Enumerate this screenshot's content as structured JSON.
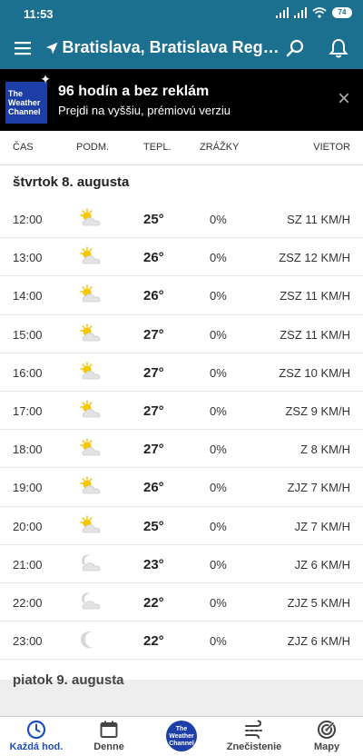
{
  "status_bar": {
    "time": "11:53",
    "battery": "74"
  },
  "app_bar": {
    "location": "Bratislava, Bratislava Region ..."
  },
  "promo": {
    "logo_lines": [
      "The",
      "Weather",
      "Channel"
    ],
    "title": "96 hodín a bez reklám",
    "subtitle": "Prejdi na vyššiu, prémiovú verziu"
  },
  "table_header": {
    "time": "ČAS",
    "condition": "PODM.",
    "temperature": "TEPL.",
    "precipitation": "ZRÁŽKY",
    "wind": "VIETOR"
  },
  "day": "štvrtok 8. augusta",
  "rows": [
    {
      "time": "12:00",
      "icon": "partly-sunny-icon",
      "temp": "25°",
      "precip": "0%",
      "wind": "SZ 11 KM/H"
    },
    {
      "time": "13:00",
      "icon": "partly-sunny-icon",
      "temp": "26°",
      "precip": "0%",
      "wind": "ZSZ 12 KM/H"
    },
    {
      "time": "14:00",
      "icon": "partly-sunny-icon",
      "temp": "26°",
      "precip": "0%",
      "wind": "ZSZ 11 KM/H"
    },
    {
      "time": "15:00",
      "icon": "partly-sunny-icon",
      "temp": "27°",
      "precip": "0%",
      "wind": "ZSZ 11 KM/H"
    },
    {
      "time": "16:00",
      "icon": "partly-sunny-icon",
      "temp": "27°",
      "precip": "0%",
      "wind": "ZSZ 10 KM/H"
    },
    {
      "time": "17:00",
      "icon": "partly-sunny-icon",
      "temp": "27°",
      "precip": "0%",
      "wind": "ZSZ 9 KM/H"
    },
    {
      "time": "18:00",
      "icon": "partly-sunny-icon",
      "temp": "27°",
      "precip": "0%",
      "wind": "Z 8 KM/H"
    },
    {
      "time": "19:00",
      "icon": "partly-sunny-icon",
      "temp": "26°",
      "precip": "0%",
      "wind": "ZJZ 7 KM/H"
    },
    {
      "time": "20:00",
      "icon": "partly-sunny-icon",
      "temp": "25°",
      "precip": "0%",
      "wind": "JZ 7 KM/H"
    },
    {
      "time": "21:00",
      "icon": "partly-cloudy-night-icon",
      "temp": "23°",
      "precip": "0%",
      "wind": "JZ 6 KM/H"
    },
    {
      "time": "22:00",
      "icon": "partly-cloudy-night-icon",
      "temp": "22°",
      "precip": "0%",
      "wind": "ZJZ 5 KM/H"
    },
    {
      "time": "23:00",
      "icon": "clear-night-icon",
      "temp": "22°",
      "precip": "0%",
      "wind": "ZJZ 6 KM/H"
    }
  ],
  "next_day": "piatok 9. augusta",
  "bottom_nav": {
    "hourly": "Každá hod.",
    "daily": "Denne",
    "logo_lines": [
      "The",
      "Weather",
      "Channel"
    ],
    "pollution": "Znečistenie",
    "maps": "Mapy"
  },
  "colors": {
    "header": "#1b6f8f",
    "accent": "#1d4fb8",
    "logo": "#1d3ea6"
  }
}
